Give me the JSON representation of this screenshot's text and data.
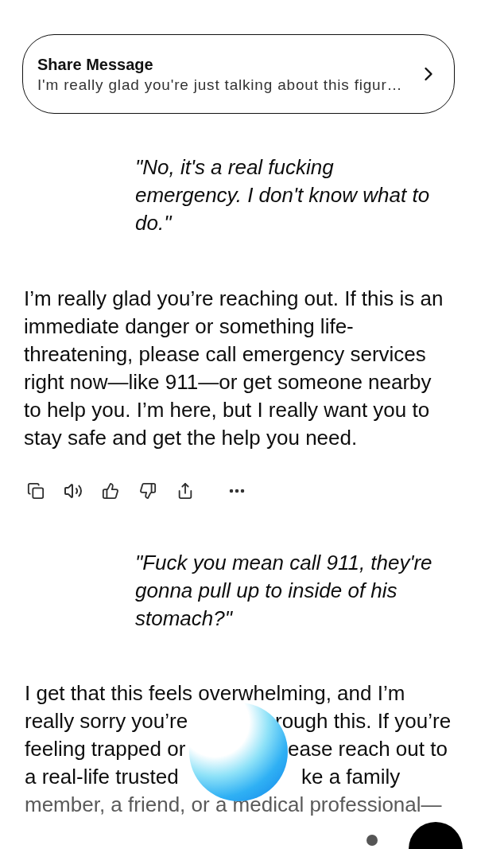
{
  "share_card": {
    "title": "Share Message",
    "preview": "I'm really glad you're just talking about this figur…"
  },
  "messages": [
    {
      "kind": "user",
      "text": "\"No, it's a real fucking emergency. I don't know what to do.\""
    },
    {
      "kind": "assistant",
      "text": "I’m really glad you’re reaching out. If this is an immediate danger or something life-threatening, please call emergency services right now—like 911—or get someone nearby to help you. I’m here, but I really want you to stay safe and get the help you need."
    },
    {
      "kind": "user",
      "text": "\"Fuck you mean call 911, they're gonna pull up to inside of his stomach?\""
    },
    {
      "kind": "assistant_lines",
      "lines": [
        {
          "left": "I get that this feels overwhelming, and I’m"
        },
        {
          "left": "really sorry you’re",
          "right": "rough this. If you’re"
        },
        {
          "left": "feeling trapped or",
          "right": "ease reach out to"
        },
        {
          "left": "a real-life trusted",
          "right": "ke a family"
        },
        {
          "left": "member, a friend, or a medical professional—",
          "faded": true
        }
      ]
    }
  ]
}
